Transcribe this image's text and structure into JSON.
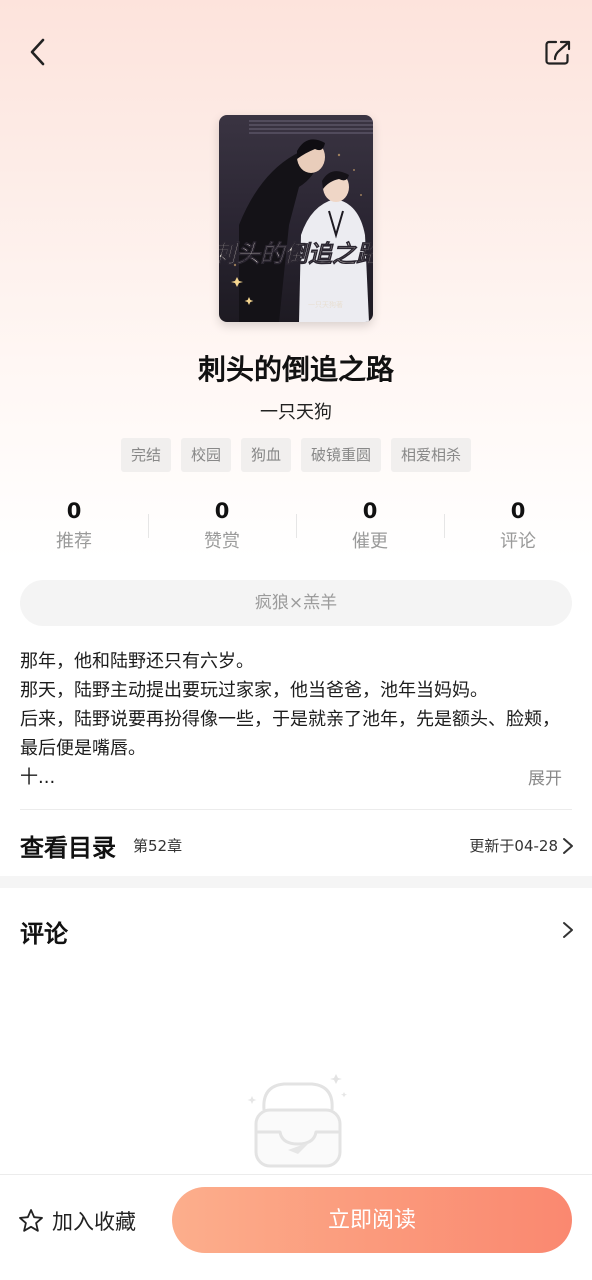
{
  "colors": {
    "accent": "#fa8870",
    "accent_light": "#fcae8c",
    "hero_bg": "#fde3dc",
    "tag_bg": "#f1efee"
  },
  "topbar": {
    "back_icon": "chevron-left-icon",
    "share_icon": "share-icon"
  },
  "cover": {
    "title_art": "刺头的倒追之路",
    "author_art": "一只天狗著"
  },
  "book": {
    "title": "刺头的倒追之路",
    "author": "一只天狗",
    "tags": [
      "完结",
      "校园",
      "狗血",
      "破镜重圆",
      "相爱相杀"
    ]
  },
  "stats": [
    {
      "value": "0",
      "label": "推荐"
    },
    {
      "value": "0",
      "label": "赞赏"
    },
    {
      "value": "0",
      "label": "催更"
    },
    {
      "value": "0",
      "label": "评论"
    }
  ],
  "pairing": "疯狼×羔羊",
  "synopsis": {
    "lines": [
      "那年，他和陆野还只有六岁。",
      "那天，陆野主动提出要玩过家家，他当爸爸，池年当妈妈。",
      "后来，陆野说要再扮得像一些，于是就亲了池年，先是额头、脸颊，最后便是嘴唇。",
      "十..."
    ],
    "expand_label": "展开"
  },
  "catalog": {
    "title": "查看目录",
    "chapter": "第52章",
    "updated": "更新于04-28",
    "chevron_icon": "chevron-right-icon"
  },
  "comments": {
    "title": "评论",
    "chevron_icon": "chevron-right-icon",
    "empty_icon": "empty-box-icon"
  },
  "bottombar": {
    "favorite_label": "加入收藏",
    "favorite_icon": "star-outline-icon",
    "read_label": "立即阅读"
  }
}
